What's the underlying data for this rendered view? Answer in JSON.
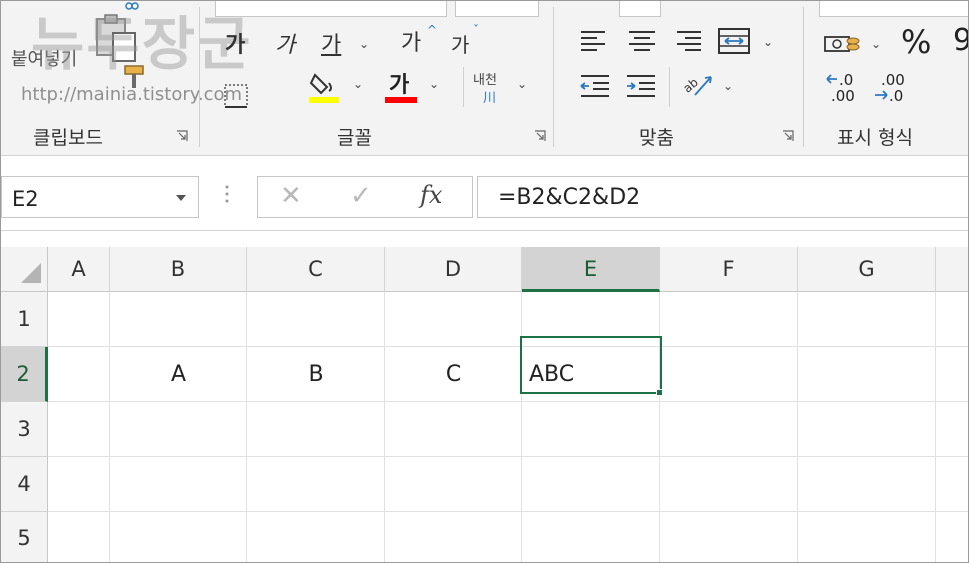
{
  "ribbon": {
    "clipboard": {
      "label": "클립보드",
      "paste_label": "붙여넣기"
    },
    "font": {
      "label": "글꼴",
      "font_size_increase": "가",
      "font_size_decrease": "가",
      "bold": "가",
      "italic": "가",
      "underline": "가",
      "font_color_letter": "가",
      "phonetic_label": "내천"
    },
    "alignment": {
      "label": "맞춤"
    },
    "number": {
      "label": "표시 형식",
      "percent": "%",
      "increase_decimal_top": ".0",
      "increase_decimal_bottom": ".00",
      "decrease_decimal_top": ".00",
      "decrease_decimal_bottom": ".0"
    },
    "colors": {
      "highlight": "#ffff00",
      "font_color": "#ff0000",
      "accent_blue": "#2b79c2",
      "accent_green": "#1e7145"
    }
  },
  "watermark": {
    "title": "뉴두장군",
    "url": "http://mainia.tistory.com"
  },
  "formula_bar": {
    "name_box": "E2",
    "cancel": "✕",
    "enter": "✓",
    "fx": "fx",
    "formula": "=B2&C2&D2"
  },
  "sheet": {
    "columns": [
      "A",
      "B",
      "C",
      "D",
      "E",
      "F",
      "G"
    ],
    "rows": [
      "1",
      "2",
      "3",
      "4",
      "5"
    ],
    "selected_column": "E",
    "selected_row": "2",
    "cells": {
      "B2": "A",
      "C2": "B",
      "D2": "C",
      "E2": "ABC"
    }
  }
}
